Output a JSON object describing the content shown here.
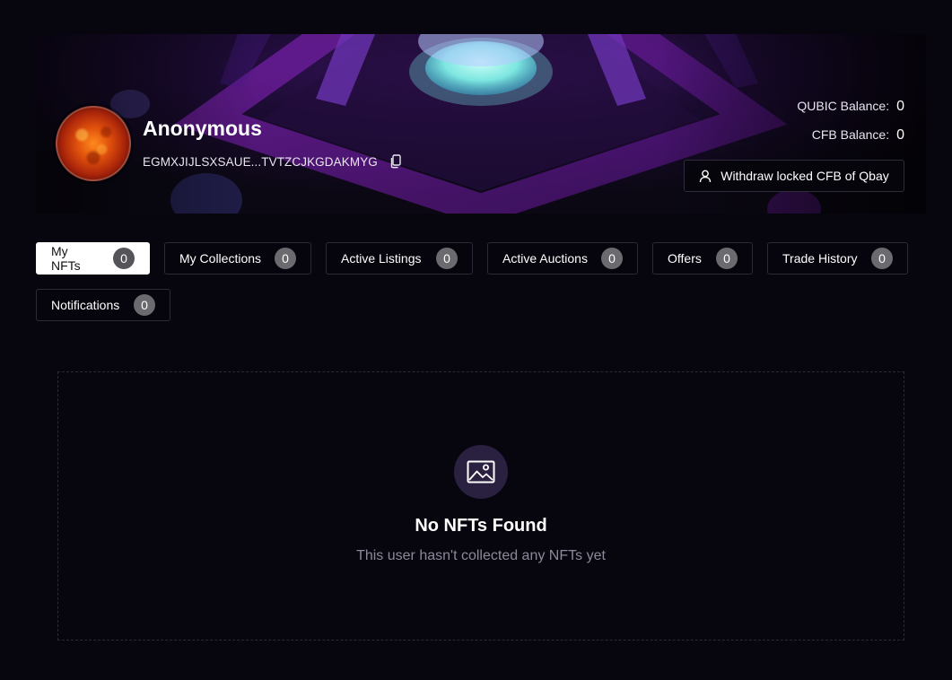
{
  "profile": {
    "name": "Anonymous",
    "wallet_address": "EGMXJIJLSXSAUE...TVTZCJKGDAKMYG"
  },
  "balances": [
    {
      "label": "QUBIC Balance:",
      "value": "0"
    },
    {
      "label": "CFB Balance:",
      "value": "0"
    }
  ],
  "withdraw_button": {
    "label": "Withdraw locked CFB of Qbay"
  },
  "tabs": [
    {
      "label": "My NFTs",
      "count": "0",
      "active": true
    },
    {
      "label": "My Collections",
      "count": "0"
    },
    {
      "label": "Active Listings",
      "count": "0"
    },
    {
      "label": "Active Auctions",
      "count": "0"
    },
    {
      "label": "Offers",
      "count": "0"
    },
    {
      "label": "Trade History",
      "count": "0"
    },
    {
      "label": "Notifications",
      "count": "0"
    }
  ],
  "empty_state": {
    "icon": "image-icon",
    "title": "No NFTs Found",
    "subtitle": "This user hasn't collected any NFTs yet"
  },
  "colors": {
    "background": "#07060f",
    "active_tab": "#ffffff",
    "badge": "#6b6b6f",
    "banner_purple": "#7a1fb8",
    "banner_glow": "#8ef0e8"
  }
}
